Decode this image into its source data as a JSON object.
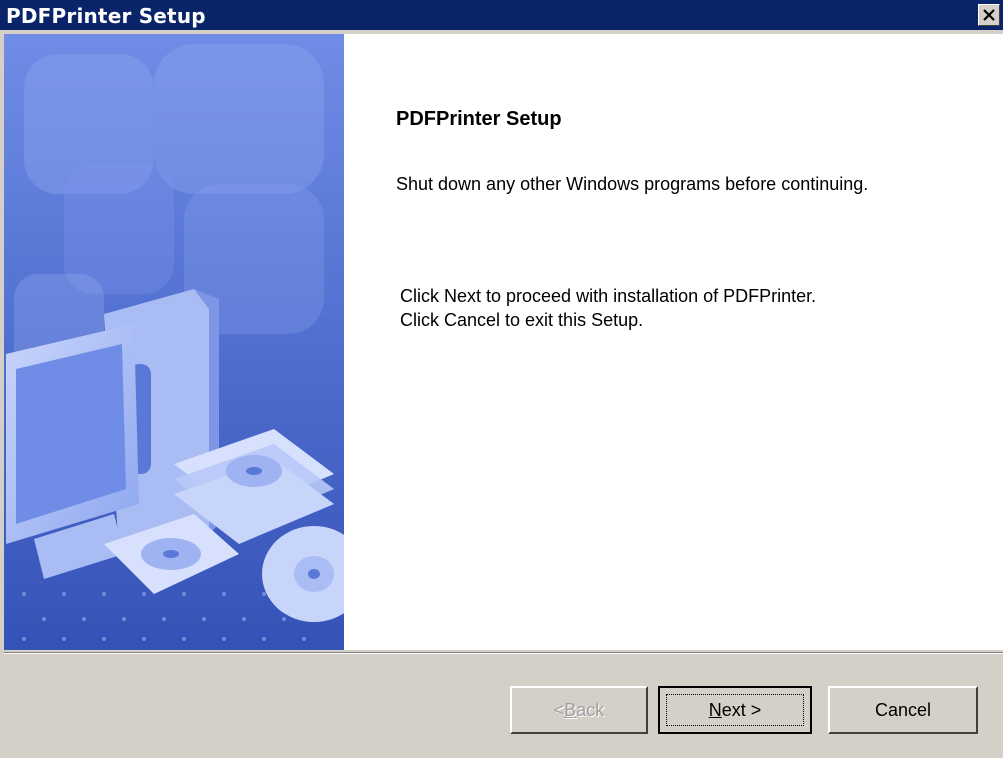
{
  "window": {
    "title": "PDFPrinter Setup"
  },
  "content": {
    "heading": "PDFPrinter Setup",
    "line1": "Shut down any other Windows programs before continuing.",
    "line2": "Click Next to proceed with installation of PDFPrinter.",
    "line3": "Click Cancel to exit this Setup."
  },
  "buttons": {
    "back_prefix": "< ",
    "back_mnemonic": "B",
    "back_rest": "ack",
    "next_mnemonic": "N",
    "next_rest": "ext >",
    "cancel": "Cancel"
  },
  "colors": {
    "titlebar": "#0a246a",
    "face": "#d4d0c8",
    "art_blue": "#5a78d8"
  }
}
